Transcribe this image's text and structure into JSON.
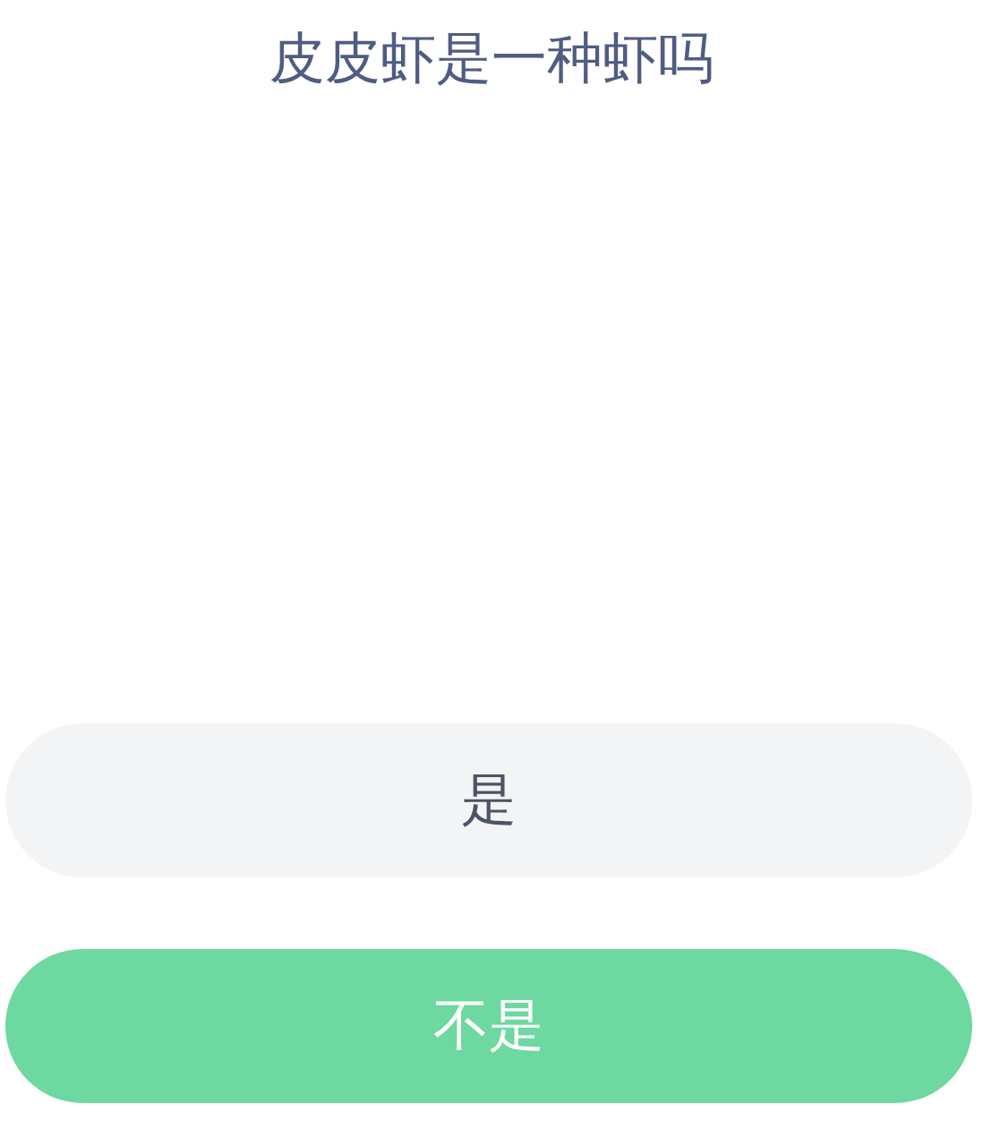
{
  "question": "皮皮虾是一种虾吗",
  "options": [
    {
      "label": "是",
      "kind": "plain"
    },
    {
      "label": "不是",
      "kind": "highlighted"
    }
  ]
}
